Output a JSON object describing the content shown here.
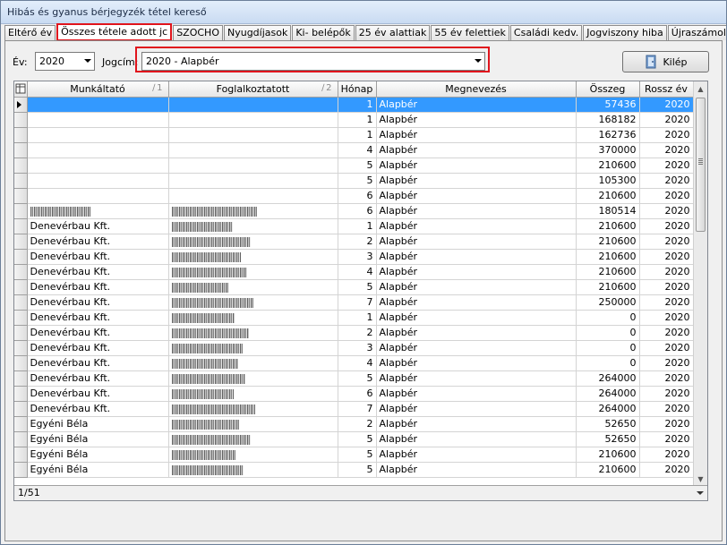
{
  "window": {
    "title": "Hibás és gyanus bérjegyzék tétel kereső"
  },
  "tabs": [
    {
      "label": "Eltérő év"
    },
    {
      "label": "Összes tétele adott jc"
    },
    {
      "label": "SZOCHO"
    },
    {
      "label": "Nyugdíjasok"
    },
    {
      "label": "Ki- belépők"
    },
    {
      "label": "25 év alattiak"
    },
    {
      "label": "55 év felettiek"
    },
    {
      "label": "Családi kedv."
    },
    {
      "label": "Jogviszony hiba"
    },
    {
      "label": "Újraszámolandó"
    }
  ],
  "active_tab": 1,
  "filters": {
    "ev_label": "Év:",
    "ev_value": "2020",
    "jogcim_label": "Jogcím:",
    "jogcim_value": "2020 - Alapbér"
  },
  "exit_button": {
    "label": "Kilép",
    "icon": "exit-door-icon"
  },
  "grid": {
    "columns": [
      {
        "label": "Munkáltató",
        "sort": "1"
      },
      {
        "label": "Foglalkoztatott",
        "sort": "2"
      },
      {
        "label": "Hónap",
        "sort": ""
      },
      {
        "label": "Megnevezés",
        "sort": ""
      },
      {
        "label": "Összeg",
        "sort": ""
      },
      {
        "label": "Rossz év",
        "sort": ""
      }
    ],
    "rows": [
      {
        "munkaltato": "",
        "foglalkoztatott": "",
        "honap": "1",
        "megnevezes": "Alapbér",
        "osszeg": "57436",
        "rossz_ev": "2020",
        "selected": true
      },
      {
        "munkaltato": "",
        "foglalkoztatott": "",
        "honap": "1",
        "megnevezes": "Alapbér",
        "osszeg": "168182",
        "rossz_ev": "2020"
      },
      {
        "munkaltato": "",
        "foglalkoztatott": "",
        "honap": "1",
        "megnevezes": "Alapbér",
        "osszeg": "162736",
        "rossz_ev": "2020"
      },
      {
        "munkaltato": "",
        "foglalkoztatott": "",
        "honap": "4",
        "megnevezes": "Alapbér",
        "osszeg": "370000",
        "rossz_ev": "2020"
      },
      {
        "munkaltato": "",
        "foglalkoztatott": "",
        "honap": "5",
        "megnevezes": "Alapbér",
        "osszeg": "210600",
        "rossz_ev": "2020"
      },
      {
        "munkaltato": "",
        "foglalkoztatott": "",
        "honap": "5",
        "megnevezes": "Alapbér",
        "osszeg": "105300",
        "rossz_ev": "2020"
      },
      {
        "munkaltato": "",
        "foglalkoztatott": "",
        "honap": "6",
        "megnevezes": "Alapbér",
        "osszeg": "210600",
        "rossz_ev": "2020"
      },
      {
        "munkaltato": "",
        "foglalkoztatott": "",
        "honap": "6",
        "megnevezes": "Alapbér",
        "osszeg": "180514",
        "rossz_ev": "2020",
        "blur_employer": true,
        "blur_employee": true
      },
      {
        "munkaltato": "Denevérbau Kft.",
        "foglalkoztatott": "",
        "honap": "1",
        "megnevezes": "Alapbér",
        "osszeg": "210600",
        "rossz_ev": "2020",
        "blur_employee": true
      },
      {
        "munkaltato": "Denevérbau Kft.",
        "foglalkoztatott": "",
        "honap": "2",
        "megnevezes": "Alapbér",
        "osszeg": "210600",
        "rossz_ev": "2020",
        "blur_employee": true
      },
      {
        "munkaltato": "Denevérbau Kft.",
        "foglalkoztatott": "",
        "honap": "3",
        "megnevezes": "Alapbér",
        "osszeg": "210600",
        "rossz_ev": "2020",
        "blur_employee": true
      },
      {
        "munkaltato": "Denevérbau Kft.",
        "foglalkoztatott": "",
        "honap": "4",
        "megnevezes": "Alapbér",
        "osszeg": "210600",
        "rossz_ev": "2020",
        "blur_employee": true
      },
      {
        "munkaltato": "Denevérbau Kft.",
        "foglalkoztatott": "",
        "honap": "5",
        "megnevezes": "Alapbér",
        "osszeg": "210600",
        "rossz_ev": "2020",
        "blur_employee": true
      },
      {
        "munkaltato": "Denevérbau Kft.",
        "foglalkoztatott": "",
        "honap": "7",
        "megnevezes": "Alapbér",
        "osszeg": "250000",
        "rossz_ev": "2020",
        "blur_employee": true
      },
      {
        "munkaltato": "Denevérbau Kft.",
        "foglalkoztatott": "",
        "honap": "1",
        "megnevezes": "Alapbér",
        "osszeg": "0",
        "rossz_ev": "2020",
        "blur_employee": true
      },
      {
        "munkaltato": "Denevérbau Kft.",
        "foglalkoztatott": "",
        "honap": "2",
        "megnevezes": "Alapbér",
        "osszeg": "0",
        "rossz_ev": "2020",
        "blur_employee": true
      },
      {
        "munkaltato": "Denevérbau Kft.",
        "foglalkoztatott": "",
        "honap": "3",
        "megnevezes": "Alapbér",
        "osszeg": "0",
        "rossz_ev": "2020",
        "blur_employee": true
      },
      {
        "munkaltato": "Denevérbau Kft.",
        "foglalkoztatott": "",
        "honap": "4",
        "megnevezes": "Alapbér",
        "osszeg": "0",
        "rossz_ev": "2020",
        "blur_employee": true
      },
      {
        "munkaltato": "Denevérbau Kft.",
        "foglalkoztatott": "",
        "honap": "5",
        "megnevezes": "Alapbér",
        "osszeg": "264000",
        "rossz_ev": "2020",
        "blur_employee": true
      },
      {
        "munkaltato": "Denevérbau Kft.",
        "foglalkoztatott": "",
        "honap": "6",
        "megnevezes": "Alapbér",
        "osszeg": "264000",
        "rossz_ev": "2020",
        "blur_employee": true
      },
      {
        "munkaltato": "Denevérbau Kft.",
        "foglalkoztatott": "",
        "honap": "7",
        "megnevezes": "Alapbér",
        "osszeg": "264000",
        "rossz_ev": "2020",
        "blur_employee": true
      },
      {
        "munkaltato": "Egyéni Béla",
        "foglalkoztatott": "",
        "honap": "2",
        "megnevezes": "Alapbér",
        "osszeg": "52650",
        "rossz_ev": "2020",
        "blur_employee": true
      },
      {
        "munkaltato": "Egyéni Béla",
        "foglalkoztatott": "",
        "honap": "5",
        "megnevezes": "Alapbér",
        "osszeg": "52650",
        "rossz_ev": "2020",
        "blur_employee": true
      },
      {
        "munkaltato": "Egyéni Béla",
        "foglalkoztatott": "",
        "honap": "5",
        "megnevezes": "Alapbér",
        "osszeg": "210600",
        "rossz_ev": "2020",
        "blur_employee": true
      },
      {
        "munkaltato": "Egyéni Béla",
        "foglalkoztatott": "",
        "honap": "5",
        "megnevezes": "Alapbér",
        "osszeg": "210600",
        "rossz_ev": "2020",
        "blur_employee": true
      }
    ]
  },
  "status": {
    "position": "1/51"
  },
  "colors": {
    "selection": "#3399ff",
    "highlight_box": "#e0141c"
  }
}
